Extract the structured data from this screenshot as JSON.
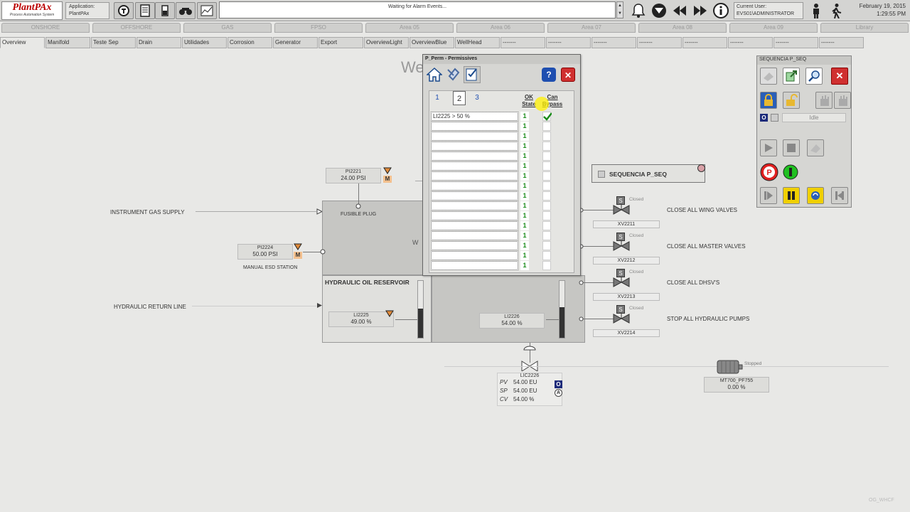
{
  "topbar": {
    "logo_title": "PlantPAx",
    "logo_subtitle": "Process Automation System",
    "app_label": "Application:",
    "app_name": "PlantPAx",
    "alarm_text": "Waiting for Alarm Events...",
    "user_label": "Current User:",
    "user_name": "EVS01\\ADMINISTRATOR",
    "date": "February 19, 2015",
    "time": "1:29:55 PM",
    "icons": [
      "alarm-summary-icon",
      "document-icon",
      "battery-icon",
      "binoculars-icon",
      "trend-icon",
      "bell-icon",
      "down-icon",
      "rewind-icon",
      "fast-forward-icon",
      "info-icon",
      "person-icon",
      "walking-person-icon"
    ]
  },
  "area_tabs": [
    "ONSHORE",
    "OFFSHORE",
    "GAS",
    "FPSO",
    "Area 05",
    "Area 06",
    "Area 07",
    "Area 08",
    "Area 09",
    "Library"
  ],
  "display_tabs": [
    "Overview",
    "Manifold",
    "Teste Sep",
    "Drain",
    "Utilidades",
    "Corrosion",
    "Generator",
    "Export",
    "OverviewLight",
    "OverviewBlue",
    "WellHead",
    "-------",
    "-------",
    "-------",
    "-------",
    "-------",
    "-------",
    "-------",
    "-------"
  ],
  "canvas": {
    "title_partial": "We",
    "inst_gas_supply": "INSTRUMENT GAS SUPPLY",
    "hyd_return": "HYDRAULIC RETURN LINE",
    "fusible_plug": "FUSIBLE PLUG",
    "manual_esd": "MANUAL ESD STATION",
    "reservoir": "HYDRAULIC OIL RESERVOIR",
    "tank_partial": "W",
    "pi2221": {
      "tag": "PI2221",
      "val": "24.00 PSI",
      "mode": "M"
    },
    "pi2224": {
      "tag": "PI2224",
      "val": "50.00 PSI",
      "mode": "M"
    },
    "li2225": {
      "tag": "LI2225",
      "val": "49.00 %"
    },
    "li2226": {
      "tag": "LI2226",
      "val": "54.00 %"
    },
    "lic2226": {
      "tag": "LIC2226",
      "pv_l": "PV",
      "pv": "54.00 EU",
      "sp_l": "SP",
      "sp": "54.00 EU",
      "cv_l": "CV",
      "cv": "54.00 %",
      "mode_o": "O",
      "mode_a": "A"
    },
    "valves": [
      {
        "tag": "XV2211",
        "state": "Closed",
        "desc": "CLOSE ALL  WING VALVES"
      },
      {
        "tag": "XV2212",
        "state": "Closed",
        "desc": "CLOSE ALL MASTER VALVES"
      },
      {
        "tag": "XV2213",
        "state": "Closed",
        "desc": "CLOSE ALL DHSV'S"
      },
      {
        "tag": "XV2214",
        "state": "Closed",
        "desc": "STOP ALL HYDRAULIC PUMPS"
      }
    ],
    "valve_s": "S",
    "motor": {
      "tag": "MT700_PF755",
      "state": "Stopped",
      "val": "0.00 %"
    },
    "seq_button": "SEQUENCIA P_SEQ",
    "footer_tag": "OG_WHCF"
  },
  "permissives": {
    "title": "P_Perm - Permissives",
    "pages": [
      "1",
      "2",
      "3"
    ],
    "col_ok": "OK State",
    "col_bypass": "Can Bypass",
    "rows": [
      {
        "label": "LI2225 > 50 %",
        "ok": "1",
        "bypass": true
      },
      {
        "label": "",
        "ok": "1",
        "bypass": false
      },
      {
        "label": "",
        "ok": "1",
        "bypass": false
      },
      {
        "label": "",
        "ok": "1",
        "bypass": false
      },
      {
        "label": "",
        "ok": "1",
        "bypass": false
      },
      {
        "label": "",
        "ok": "1",
        "bypass": false
      },
      {
        "label": "",
        "ok": "1",
        "bypass": false
      },
      {
        "label": "",
        "ok": "1",
        "bypass": false
      },
      {
        "label": "",
        "ok": "1",
        "bypass": false
      },
      {
        "label": "",
        "ok": "1",
        "bypass": false
      },
      {
        "label": "",
        "ok": "1",
        "bypass": false
      },
      {
        "label": "",
        "ok": "1",
        "bypass": false
      },
      {
        "label": "",
        "ok": "1",
        "bypass": false
      },
      {
        "label": "",
        "ok": "1",
        "bypass": false
      },
      {
        "label": "",
        "ok": "1",
        "bypass": false
      },
      {
        "label": "",
        "ok": "1",
        "bypass": false
      }
    ],
    "help": "?",
    "close": "✕"
  },
  "seq_panel": {
    "title": "SEQUENCIA P_SEQ",
    "state": "Idle",
    "mode_o": "O"
  }
}
